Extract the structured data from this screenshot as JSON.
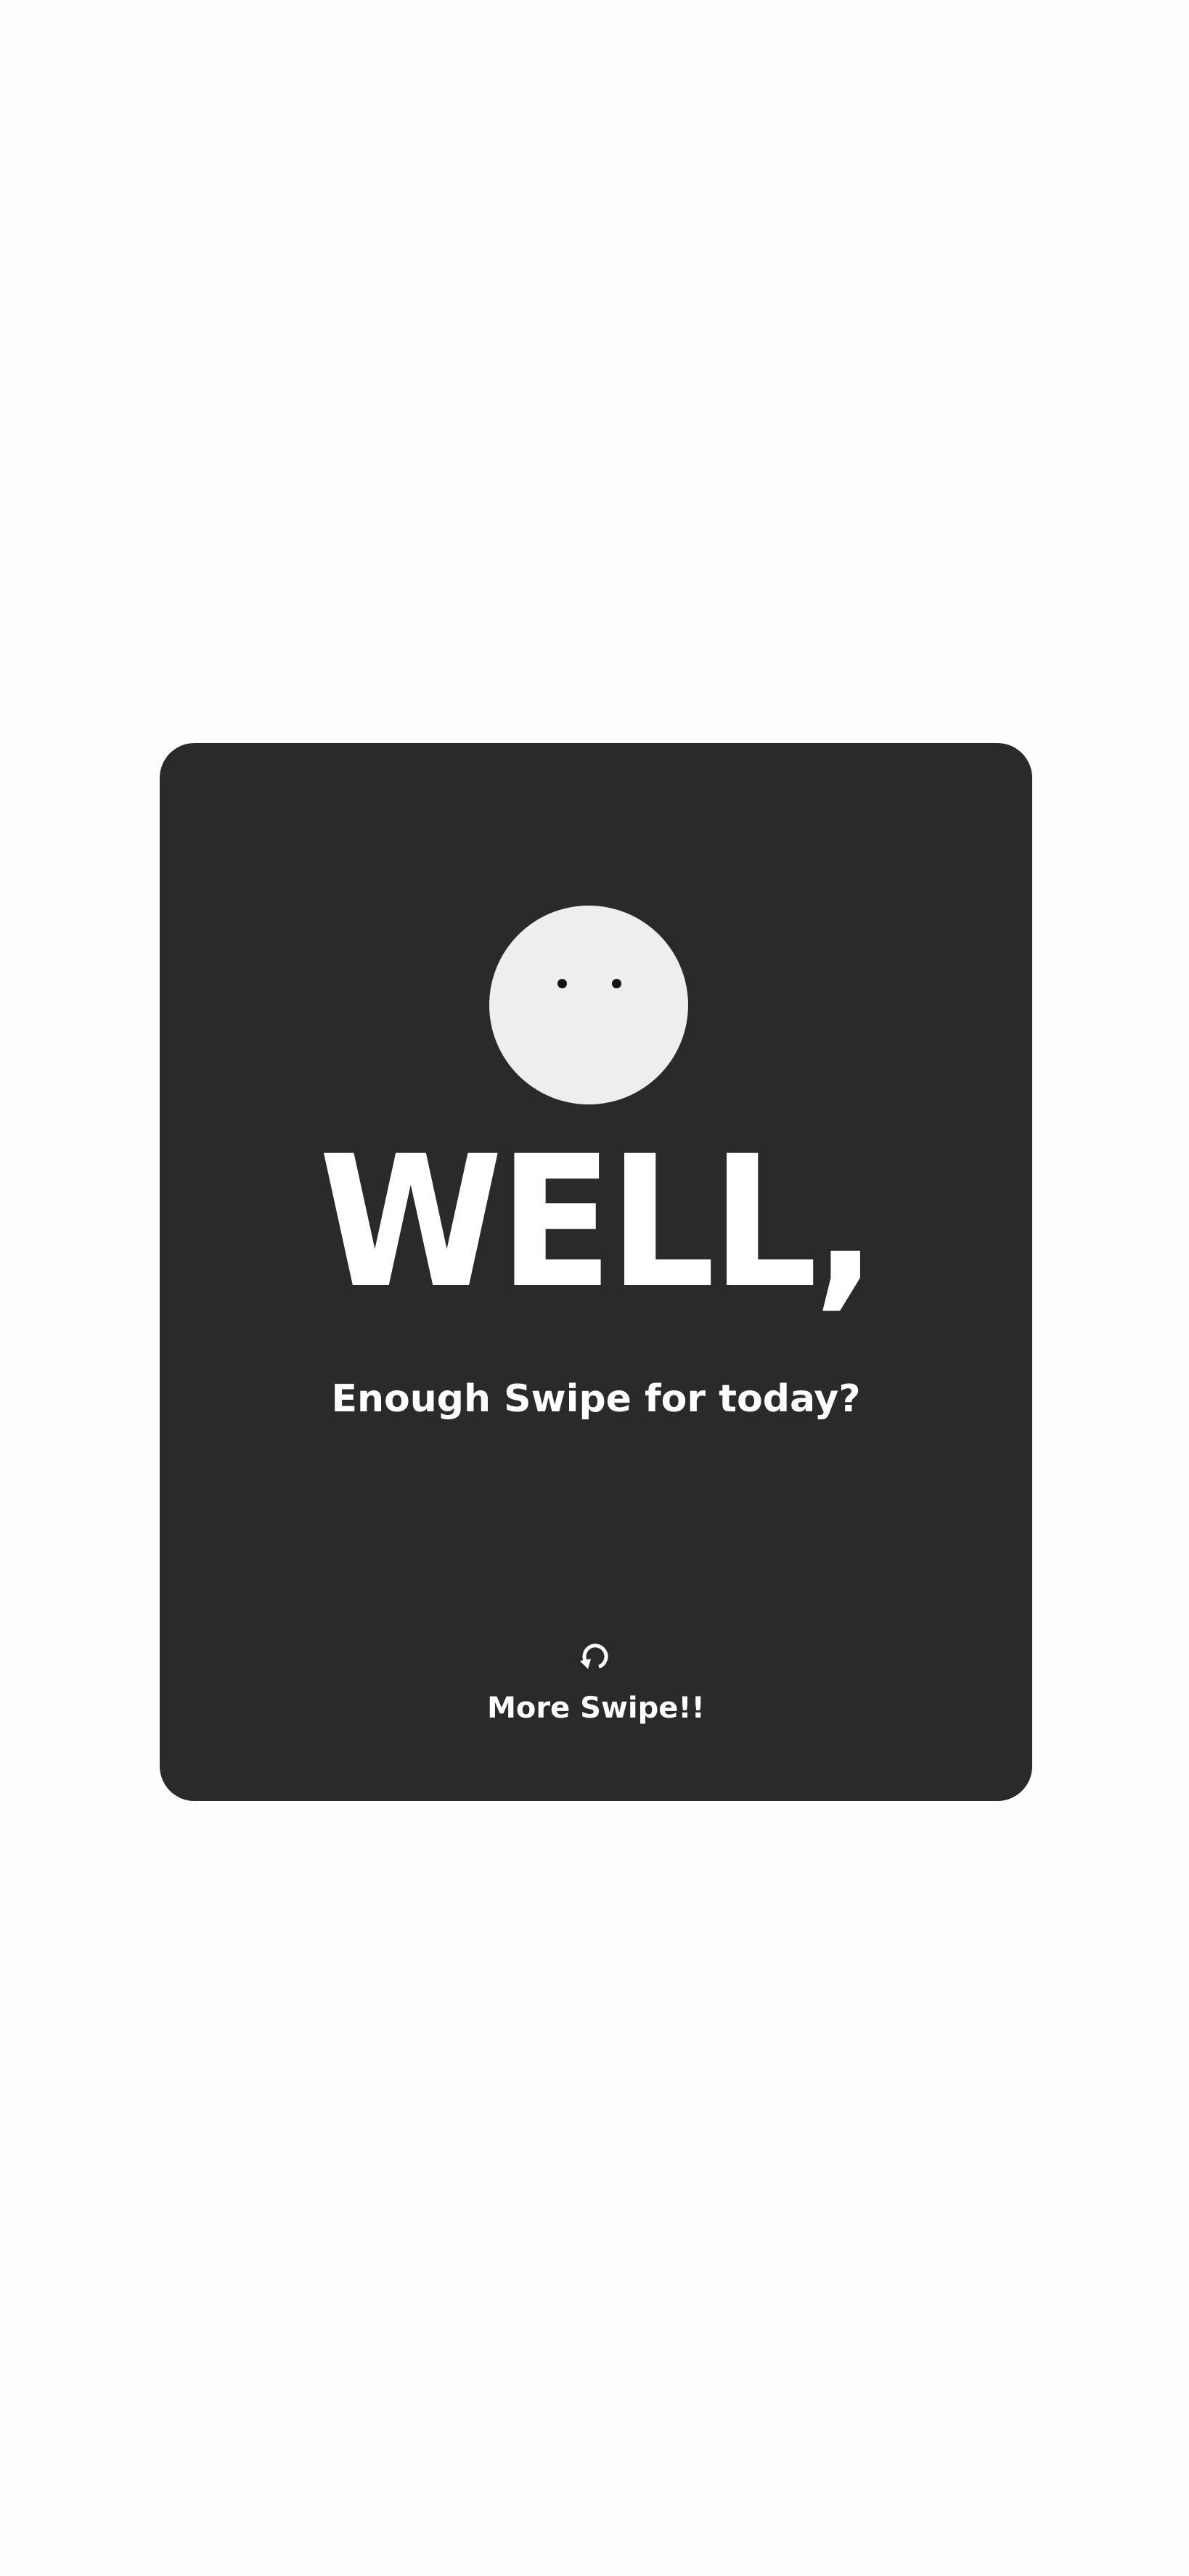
{
  "card": {
    "headline": "WELL,",
    "subtitle": "Enough Swipe for  today?",
    "face_icon": "face-icon",
    "action": {
      "icon": "refresh-icon",
      "label": "More Swipe!!"
    }
  },
  "colors": {
    "page_background": "#fdfdfd",
    "card_background": "#2a2a2a",
    "face": "#eeeeee",
    "eyes": "#141414",
    "text": "#ffffff"
  }
}
